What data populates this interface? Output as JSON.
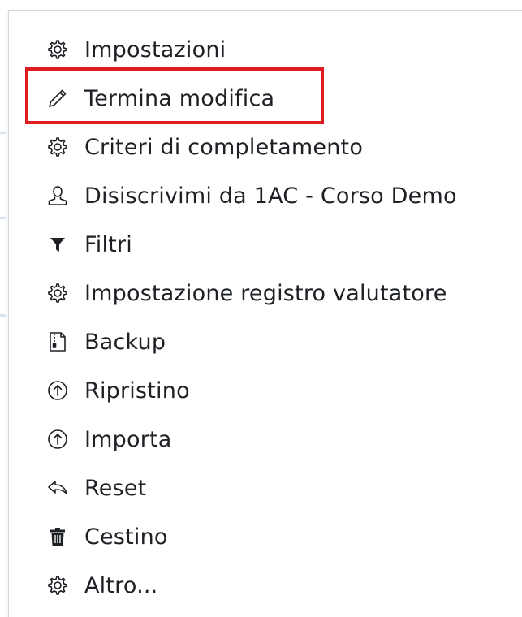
{
  "colors": {
    "text": "#1d2125",
    "highlight": "#e11b22",
    "border": "#d6d6d6"
  },
  "menu": {
    "items": [
      {
        "label": "Impostazioni",
        "icon": "gear-icon"
      },
      {
        "label": "Termina modifica",
        "icon": "pencil-icon"
      },
      {
        "label": "Criteri di completamento",
        "icon": "gear-icon"
      },
      {
        "label": "Disiscrivimi da 1AC - Corso Demo",
        "icon": "user-icon"
      },
      {
        "label": "Filtri",
        "icon": "filter-icon"
      },
      {
        "label": "Impostazione registro valutatore",
        "icon": "gear-icon"
      },
      {
        "label": "Backup",
        "icon": "file-archive-icon"
      },
      {
        "label": "Ripristino",
        "icon": "arrow-up-circle-icon"
      },
      {
        "label": "Importa",
        "icon": "arrow-up-circle-icon"
      },
      {
        "label": "Reset",
        "icon": "reply-arrow-icon"
      },
      {
        "label": "Cestino",
        "icon": "trash-icon"
      },
      {
        "label": "Altro...",
        "icon": "gear-icon"
      }
    ]
  }
}
